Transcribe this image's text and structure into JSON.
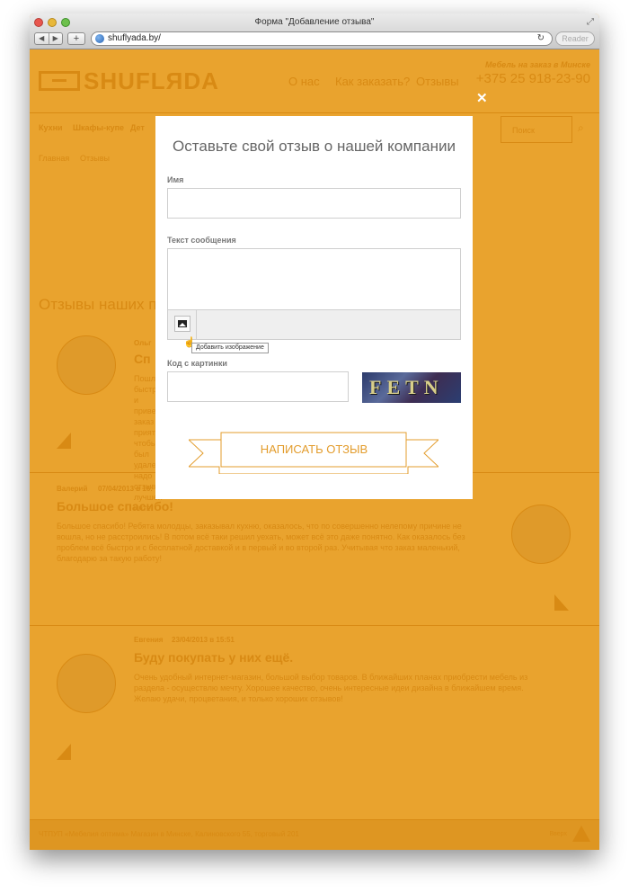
{
  "browser": {
    "window_title": "Форма \"Добавление отзыва\"",
    "url": "shuflyada.by/",
    "reader_label": "Reader"
  },
  "site": {
    "logo": "SHUFLЯDA",
    "nav": [
      "О нас",
      "Как заказать?",
      "Отзывы"
    ],
    "phone_caption": "Мебель на заказ в Минске",
    "phone": "+375 25 918-23-90",
    "menu": [
      "Кухни",
      "Шкафы-купе",
      "Дет"
    ],
    "search_placeholder": "Поиск",
    "breadcrumb": [
      "Главная",
      "Отзывы"
    ],
    "reviews_heading": "Отзывы наших по",
    "reviews": [
      {
        "name": "Ольг",
        "title": "Сп",
        "text": "Пошл быстрой и приветливо заказ приятной чтобы был удален надо отзыв лучшей инте"
      },
      {
        "name": "Валерий",
        "date": "07/04/2013 в 16:",
        "title": "Большое спасибо!",
        "text": "Большое спасибо! Ребята молодцы, заказывал кухню, оказалось, что по совершенно нелепому причине не вошла, но не расстроились! В потом всё таки решил уехать, может всё это даже понятно. Как оказалось без проблем всё быстро и с бесплатной доставкой и в первый и во второй раз. Учитывая что заказ маленький, благодарю за такую работу!"
      },
      {
        "name": "Евгения",
        "date": "23/04/2013 в 15:51",
        "title": "Буду покупать у них ещё.",
        "text": "Очень удобный интернет-магазин, большой выбор товаров. В ближайших планах приобрести мебель из раздела - осуществлю мечту. Хорошее качество, очень интересные идеи дизайна в ближайшем время. Желаю удачи, процветания, и только хороших отзывов!"
      }
    ],
    "footer": "ЧТПУП «Мебелия оптима» Магазин в Минске, Калиновского 55, торговый 201",
    "footer_up": "Вверх"
  },
  "modal": {
    "title": "Оставьте свой отзыв о нашей компании",
    "name_label": "Имя",
    "name_value": "",
    "message_label": "Текст сообщения",
    "message_value": "",
    "add_image_tooltip": "Добавить изображение",
    "captcha_label": "Код с картинки",
    "captcha_value": "",
    "captcha_text": "FETN",
    "submit_label": "НАПИСАТЬ ОТЗЫВ",
    "close_icon": "close-icon"
  },
  "colors": {
    "overlay": "#e9a32e",
    "accent": "#e39c2c",
    "modal_bg": "#ffffff"
  }
}
